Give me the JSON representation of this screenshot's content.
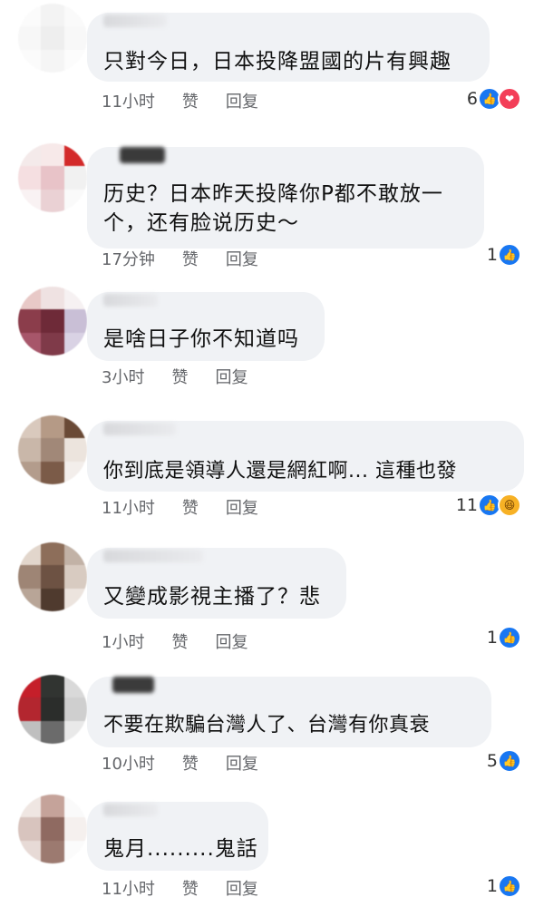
{
  "actions": {
    "like": "赞",
    "like_alt": "赞",
    "reply": "回复",
    "reply_alt": "回复"
  },
  "comments": [
    {
      "text": "只對今日，日本投降盟國的片有興趣",
      "time": "11小时",
      "like_label": "赞",
      "reply_label": "回复",
      "reaction_count": "6",
      "reactions": [
        "like-icon",
        "love-icon"
      ]
    },
    {
      "text": "历史？日本昨天投降你P都不敢放一\n个，还有脸说历史～",
      "time": "17分钟",
      "like_label": "赞",
      "reply_label": "回复",
      "reaction_count": "1",
      "reactions": [
        "like-icon"
      ]
    },
    {
      "text": "是啥日子你不知道吗",
      "time": "3小时",
      "like_label": "赞",
      "reply_label": "回复",
      "reaction_count": "",
      "reactions": []
    },
    {
      "text": "你到底是領導人還是網紅啊... 這種也發",
      "time": "11小时",
      "like_label": "赞",
      "reply_label": "回复",
      "reaction_count": "11",
      "reactions": [
        "like-icon",
        "haha-icon"
      ]
    },
    {
      "text": "又變成影視主播了？悲",
      "time": "1小时",
      "like_label": "赞",
      "reply_label": "回复",
      "reaction_count": "1",
      "reactions": [
        "like-icon"
      ]
    },
    {
      "text": "不要在欺騙台灣人了、台灣有你真衰",
      "time": "10小时",
      "like_label": "赞",
      "reply_label": "回复",
      "reaction_count": "5",
      "reactions": [
        "like-icon"
      ]
    },
    {
      "text": "鬼月.........鬼話",
      "time": "11小时",
      "like_label": "赞",
      "reply_label": "回复",
      "reaction_count": "1",
      "reactions": [
        "like-icon"
      ]
    }
  ],
  "colors": {
    "bubble": "#f0f2f5",
    "meta": "#65676b",
    "like": "#1877f2",
    "love": "#f33e58",
    "haha": "#f7b125"
  }
}
